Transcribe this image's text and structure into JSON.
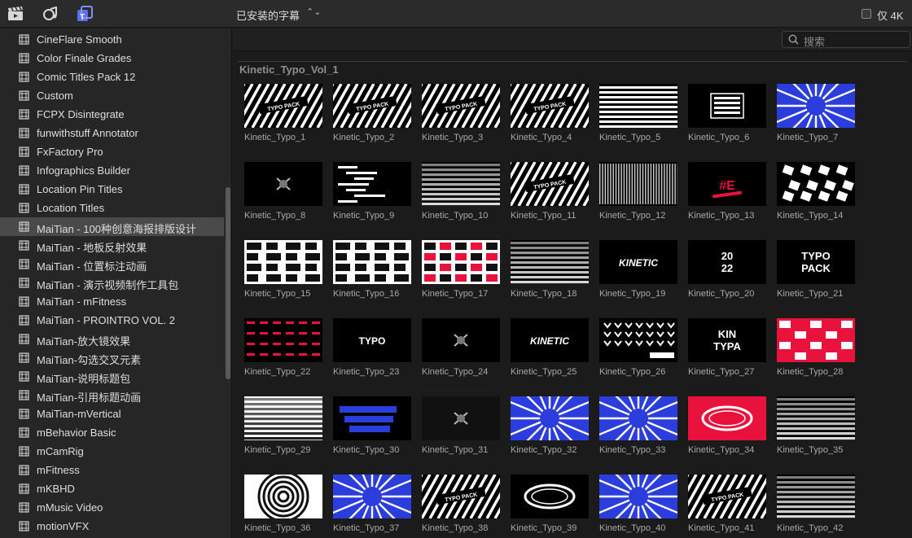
{
  "toolbar": {
    "icons": [
      "clapper-icon",
      "music-icon",
      "titles-icon"
    ],
    "title": "已安装的字幕",
    "chevron": "⌃⌄",
    "only4k_label": "仅 4K"
  },
  "search": {
    "placeholder": "搜索"
  },
  "sidebar": {
    "items": [
      {
        "label": "CineFlare Smooth"
      },
      {
        "label": "Color Finale Grades"
      },
      {
        "label": "Comic Titles Pack 12"
      },
      {
        "label": "Custom"
      },
      {
        "label": "FCPX Disintegrate"
      },
      {
        "label": "funwithstuff Annotator"
      },
      {
        "label": "FxFactory Pro"
      },
      {
        "label": "Infographics Builder"
      },
      {
        "label": "Location Pin Titles"
      },
      {
        "label": "Location Titles"
      },
      {
        "label": "MaiTian - 100种创意海报排版设计",
        "selected": true
      },
      {
        "label": "MaiTian - 地板反射效果"
      },
      {
        "label": "MaiTian - 位置标注动画"
      },
      {
        "label": "MaiTian - 演示视频制作工具包"
      },
      {
        "label": "MaiTian - mFitness"
      },
      {
        "label": "MaiTian - PROINTRO VOL. 2"
      },
      {
        "label": "MaiTian-放大镜效果"
      },
      {
        "label": "MaiTian-勾选交叉元素"
      },
      {
        "label": "MaiTian-说明标题包"
      },
      {
        "label": "MaiTian-引用标题动画"
      },
      {
        "label": "MaiTian-mVertical"
      },
      {
        "label": "mBehavior Basic"
      },
      {
        "label": "mCamRig"
      },
      {
        "label": "mFitness"
      },
      {
        "label": "mKBHD"
      },
      {
        "label": "mMusic Video"
      },
      {
        "label": "motionVFX"
      }
    ]
  },
  "section_title": "Kinetic_Typo_Vol_1",
  "titles": [
    {
      "label": "Kinetic_Typo_1",
      "style": "stripes-diag",
      "bg": "#000000"
    },
    {
      "label": "Kinetic_Typo_2",
      "style": "stripes-diag",
      "bg": "#000000"
    },
    {
      "label": "Kinetic_Typo_3",
      "style": "stripes-diag",
      "bg": "#000000"
    },
    {
      "label": "Kinetic_Typo_4",
      "style": "stripes-diag",
      "bg": "#000000"
    },
    {
      "label": "Kinetic_Typo_5",
      "style": "stripes-h",
      "bg": "#000000"
    },
    {
      "label": "Kinetic_Typo_6",
      "style": "box",
      "bg": "#000000"
    },
    {
      "label": "Kinetic_Typo_7",
      "style": "blue-burst",
      "bg": "#2b3ddc"
    },
    {
      "label": "Kinetic_Typo_8",
      "style": "dark-center",
      "bg": "#000000"
    },
    {
      "label": "Kinetic_Typo_9",
      "style": "text-small",
      "bg": "#000000"
    },
    {
      "label": "Kinetic_Typo_10",
      "style": "text-rows",
      "bg": "#000000"
    },
    {
      "label": "Kinetic_Typo_11",
      "style": "stripes-diag",
      "bg": "#000000"
    },
    {
      "label": "Kinetic_Typo_12",
      "style": "stripes-v",
      "bg": "#000000"
    },
    {
      "label": "Kinetic_Typo_13",
      "style": "red-text",
      "bg": "#000000"
    },
    {
      "label": "Kinetic_Typo_14",
      "style": "cubes",
      "bg": "#000000"
    },
    {
      "label": "Kinetic_Typo_15",
      "style": "grid-white",
      "bg": "#ffffff"
    },
    {
      "label": "Kinetic_Typo_16",
      "style": "grid-white",
      "bg": "#ffffff"
    },
    {
      "label": "Kinetic_Typo_17",
      "style": "red-grid",
      "bg": "#ffffff"
    },
    {
      "label": "Kinetic_Typo_18",
      "style": "text-rows",
      "bg": "#000000"
    },
    {
      "label": "Kinetic_Typo_19",
      "style": "word",
      "bg": "#000000",
      "word": "KINETIC"
    },
    {
      "label": "Kinetic_Typo_20",
      "style": "word",
      "bg": "#000000",
      "word": "20 22"
    },
    {
      "label": "Kinetic_Typo_21",
      "style": "word",
      "bg": "#000000",
      "word": "TYPO PACK"
    },
    {
      "label": "Kinetic_Typo_22",
      "style": "red-dots",
      "bg": "#000000"
    },
    {
      "label": "Kinetic_Typo_23",
      "style": "word",
      "bg": "#000000",
      "word": "TYPO"
    },
    {
      "label": "Kinetic_Typo_24",
      "style": "dark-center",
      "bg": "#000000"
    },
    {
      "label": "Kinetic_Typo_25",
      "style": "word",
      "bg": "#000000",
      "word": "KINETIC"
    },
    {
      "label": "Kinetic_Typo_26",
      "style": "arrows",
      "bg": "#000000"
    },
    {
      "label": "Kinetic_Typo_27",
      "style": "word",
      "bg": "#000000",
      "word": "KIN TYPA"
    },
    {
      "label": "Kinetic_Typo_28",
      "style": "red-grid",
      "bg": "#e8123c"
    },
    {
      "label": "Kinetic_Typo_29",
      "style": "text-rows",
      "bg": "#ffffff"
    },
    {
      "label": "Kinetic_Typo_30",
      "style": "blue-word",
      "bg": "#000000"
    },
    {
      "label": "Kinetic_Typo_31",
      "style": "dark-center",
      "bg": "#111111"
    },
    {
      "label": "Kinetic_Typo_32",
      "style": "blue-burst",
      "bg": "#2b3ddc"
    },
    {
      "label": "Kinetic_Typo_33",
      "style": "blue-burst",
      "bg": "#2b3ddc"
    },
    {
      "label": "Kinetic_Typo_34",
      "style": "red-ring",
      "bg": "#e8123c"
    },
    {
      "label": "Kinetic_Typo_35",
      "style": "text-rows",
      "bg": "#000000"
    },
    {
      "label": "Kinetic_Typo_36",
      "style": "rings",
      "bg": "#ffffff"
    },
    {
      "label": "Kinetic_Typo_37",
      "style": "blue-burst",
      "bg": "#2b3ddc"
    },
    {
      "label": "Kinetic_Typo_38",
      "style": "stripes-diag",
      "bg": "#000000"
    },
    {
      "label": "Kinetic_Typo_39",
      "style": "red-ring",
      "bg": "#000000"
    },
    {
      "label": "Kinetic_Typo_40",
      "style": "blue-burst",
      "bg": "#2b3ddc"
    },
    {
      "label": "Kinetic_Typo_41",
      "style": "stripes-diag",
      "bg": "#000000"
    },
    {
      "label": "Kinetic_Typo_42",
      "style": "text-rows",
      "bg": "#000000"
    }
  ]
}
